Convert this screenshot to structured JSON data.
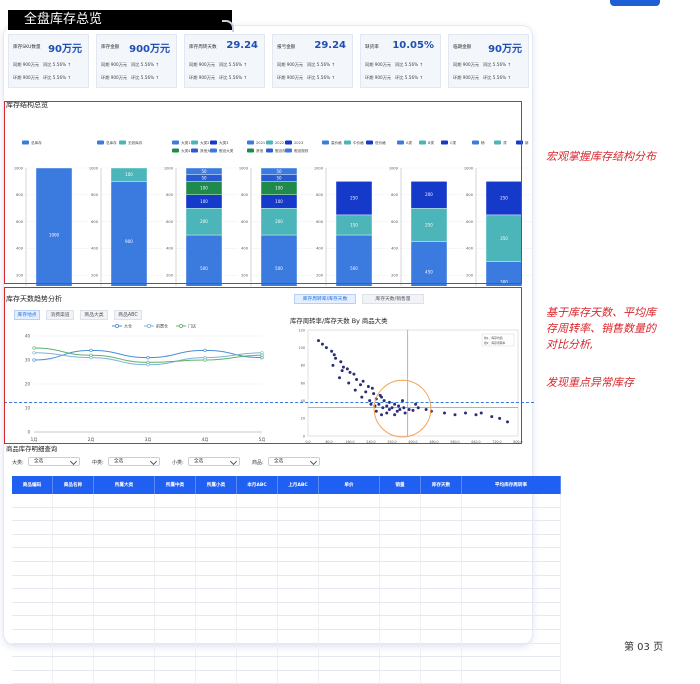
{
  "page": {
    "title": "全盘库存总览"
  },
  "kpis": [
    {
      "label": "库存SKU数量",
      "value": "90万元",
      "r1a": "同期 900万元",
      "r1b": "同比 5.56%",
      "r2a": "环期 900万元",
      "r2b": "环比 5.56%"
    },
    {
      "label": "库存金额",
      "value": "900万元",
      "r1a": "同期 900万元",
      "r1b": "同比 5.56%",
      "r2a": "环期 900万元",
      "r2b": "环比 5.56%"
    },
    {
      "label": "库存周转天数",
      "value": "29.24",
      "r1a": "同期 900万元",
      "r1b": "同比 5.56%",
      "r2a": "环期 900万元",
      "r2b": "环比 5.56%"
    },
    {
      "label": "报亏金额",
      "value": "29.24",
      "r1a": "同期 900万元",
      "r1b": "同比 5.56%",
      "r2a": "环期 900万元",
      "r2b": "环比 5.56%"
    },
    {
      "label": "缺货率",
      "value": "10.05%",
      "r1a": "同期 900万元",
      "r1b": "同比 5.56%",
      "r2a": "环期 900万元",
      "r2b": "环比 5.56%"
    },
    {
      "label": "临期金额",
      "value": "90万元",
      "r1a": "同期 900万元",
      "r1b": "同比 5.56%",
      "r2a": "环期 900万元",
      "r2b": "环比 5.56%"
    }
  ],
  "structure": {
    "title": "库存结构总览",
    "colors": [
      "#3b7be0",
      "#4bb5b9",
      "#1539c9",
      "#1f8a4c",
      "#2a5acf"
    ],
    "charts": [
      {
        "xlabel": "总库存",
        "legend": [
          "总库存"
        ],
        "segments": [
          {
            "v": 1000,
            "label": "1000"
          }
        ]
      },
      {
        "xlabel": "有效库存",
        "legend": [
          "总库存",
          "无效库存"
        ],
        "segments": [
          {
            "v": 900,
            "label": "900"
          },
          {
            "v": 100,
            "label": "100"
          }
        ]
      },
      {
        "xlabel": "大类库存结构",
        "legend": [
          "大类1",
          "大类2",
          "大类3",
          "大类4",
          "其他大类",
          "假设大类"
        ],
        "segments": [
          {
            "v": 500,
            "label": "500"
          },
          {
            "v": 200,
            "label": "200"
          },
          {
            "v": 100,
            "label": "100"
          },
          {
            "v": 100,
            "label": "100"
          },
          {
            "v": 50,
            "label": "50"
          },
          {
            "v": 50,
            "label": "50"
          }
        ]
      },
      {
        "xlabel": "商品年份",
        "legend": [
          "2021",
          "2022",
          "2023",
          "其他",
          "假设存货",
          "假设规则"
        ],
        "segments": [
          {
            "v": 500,
            "label": "500"
          },
          {
            "v": 200,
            "label": "200"
          },
          {
            "v": 100,
            "label": "100"
          },
          {
            "v": 100,
            "label": "100"
          },
          {
            "v": 50,
            "label": "50"
          },
          {
            "v": 50,
            "label": "50"
          }
        ]
      },
      {
        "xlabel": "价格带",
        "legend": [
          "高价格",
          "中价格",
          "低价格"
        ],
        "segments": [
          {
            "v": 500,
            "label": "500"
          },
          {
            "v": 150,
            "label": "150"
          },
          {
            "v": 250,
            "label": "250"
          }
        ]
      },
      {
        "xlabel": "库龄段",
        "legend": [
          "A类",
          "B类",
          "C类"
        ],
        "segments": [
          {
            "v": 450,
            "label": "450"
          },
          {
            "v": 250,
            "label": "250"
          },
          {
            "v": 200,
            "label": "200"
          }
        ]
      },
      {
        "xlabel": "新旧程度",
        "legend": [
          "畅",
          "滞",
          "新"
        ],
        "segments": [
          {
            "v": 300,
            "label": "300"
          },
          {
            "v": 350,
            "label": "350"
          },
          {
            "v": 250,
            "label": "250"
          }
        ]
      }
    ]
  },
  "trend": {
    "title": "库存天数趋势分析",
    "tabs": [
      "库存地点",
      "消费渠道",
      "商品大类",
      "商品ABC"
    ],
    "chart_data": {
      "type": "line",
      "x": [
        "1月",
        "2月",
        "3月",
        "4月",
        "5月"
      ],
      "ylim": [
        0,
        40
      ],
      "series": [
        {
          "name": "大仓",
          "color": "#4a8ed8",
          "values": [
            30,
            34,
            31,
            34,
            31
          ]
        },
        {
          "name": "前置仓",
          "color": "#7fb0d8",
          "values": [
            33,
            31,
            28,
            31,
            33
          ]
        },
        {
          "name": "门店",
          "color": "#5fb36a",
          "values": [
            35,
            32,
            29,
            30,
            32
          ]
        }
      ]
    }
  },
  "scatter": {
    "tabs": [
      "库存周转率/库存天数",
      "库存天数/销售量"
    ],
    "title": "库存周转率/库存天数 By 商品大类",
    "legend": [
      "线1：库存均值",
      "线2：库存周转率"
    ],
    "chart_data": {
      "type": "scatter",
      "xlim": [
        0,
        800
      ],
      "ylim": [
        0,
        120
      ],
      "points": [
        [
          40,
          108
        ],
        [
          55,
          104
        ],
        [
          70,
          100
        ],
        [
          90,
          96
        ],
        [
          100,
          92
        ],
        [
          105,
          88
        ],
        [
          125,
          84
        ],
        [
          95,
          80
        ],
        [
          135,
          78
        ],
        [
          150,
          76
        ],
        [
          130,
          74
        ],
        [
          160,
          72
        ],
        [
          175,
          70
        ],
        [
          120,
          66
        ],
        [
          185,
          64
        ],
        [
          210,
          62
        ],
        [
          155,
          60
        ],
        [
          200,
          58
        ],
        [
          230,
          56
        ],
        [
          245,
          54
        ],
        [
          180,
          52
        ],
        [
          220,
          50
        ],
        [
          250,
          48
        ],
        [
          275,
          46
        ],
        [
          205,
          44
        ],
        [
          260,
          42
        ],
        [
          290,
          40
        ],
        [
          235,
          40
        ],
        [
          310,
          38
        ],
        [
          270,
          36
        ],
        [
          330,
          36
        ],
        [
          300,
          34
        ],
        [
          345,
          34
        ],
        [
          255,
          34
        ],
        [
          320,
          32
        ],
        [
          285,
          32
        ],
        [
          365,
          32
        ],
        [
          385,
          30
        ],
        [
          310,
          30
        ],
        [
          350,
          30
        ],
        [
          400,
          29
        ],
        [
          260,
          28
        ],
        [
          340,
          28
        ],
        [
          420,
          32
        ],
        [
          450,
          30
        ],
        [
          300,
          26
        ],
        [
          370,
          26
        ],
        [
          470,
          28
        ],
        [
          280,
          24
        ],
        [
          330,
          24
        ],
        [
          520,
          26
        ],
        [
          560,
          24
        ],
        [
          600,
          26
        ],
        [
          640,
          24
        ],
        [
          660,
          26
        ],
        [
          700,
          22
        ],
        [
          730,
          20
        ],
        [
          760,
          16
        ],
        [
          280,
          44
        ],
        [
          360,
          40
        ],
        [
          410,
          36
        ],
        [
          240,
          36
        ]
      ],
      "vline": 380,
      "hline": 32,
      "circle": {
        "cx": 360,
        "cy": 31,
        "r": 108
      }
    },
    "xticks": [
      "0.0",
      "80.0",
      "160.0",
      "240.0",
      "320.0",
      "400.0",
      "480.0",
      "560.0",
      "640.0",
      "720.0",
      "800.0"
    ],
    "yticks": [
      "0",
      "20",
      "40",
      "60",
      "80",
      "100",
      "120"
    ]
  },
  "detail": {
    "title": "商品库存明细查询",
    "filters": [
      {
        "label": "大类:",
        "value": "全选"
      },
      {
        "label": "中类:",
        "value": "全选"
      },
      {
        "label": "小类:",
        "value": "全选"
      },
      {
        "label": "商品:",
        "value": "全选"
      }
    ],
    "columns": [
      "商品编码",
      "商品名称",
      "所属大类",
      "所属中类",
      "所属小类",
      "本月ABC",
      "上月ABC",
      "单价",
      "销量",
      "库存天数",
      "平均库存周转率"
    ]
  },
  "annotations": {
    "a1": "宏观掌握库存结构分布",
    "a2": [
      "基于库存天数、平均库",
      "存周转率、销售数量的",
      "对比分析,"
    ],
    "a3": "发现重点异常库存"
  },
  "footer": {
    "page": "第 03 页"
  }
}
